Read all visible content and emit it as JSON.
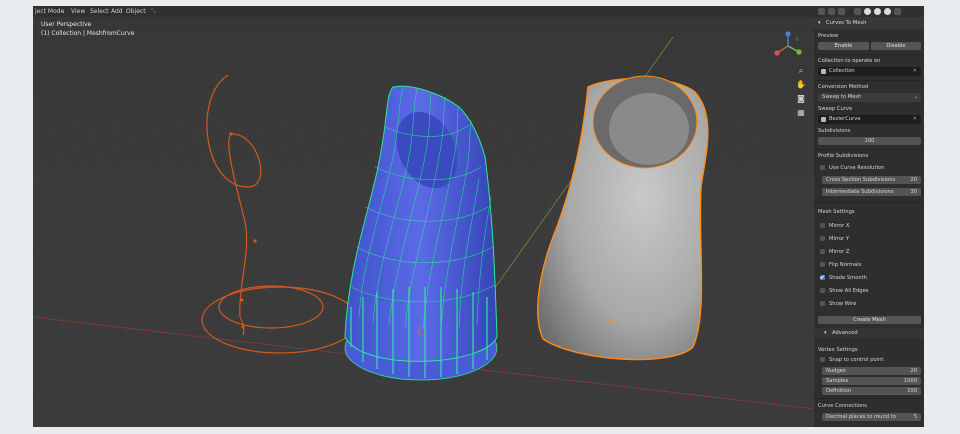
{
  "header": {
    "mode": "ject Mode",
    "menu": [
      "View",
      "Select",
      "Add",
      "Object"
    ]
  },
  "viewport": {
    "perspective": "User Perspective",
    "collection": "(1) Collection | MeshfromCurve"
  },
  "panel": {
    "title": "Curves To Mesh",
    "preview": {
      "label": "Preview",
      "enable": "Enable",
      "disable": "Disable"
    },
    "collection": {
      "label": "Collection to operate on",
      "value": "Collection"
    },
    "conversion": {
      "label": "Conversion Method",
      "value": "Sweep to Mesh"
    },
    "sweep": {
      "label": "Sweep Curve",
      "value": "BezierCurve"
    },
    "subdivisions": {
      "label": "Subdivisions",
      "value": "100"
    },
    "profile": {
      "label": "Profile Subdivisions",
      "use_curve": "Use Curve Resolution",
      "cross_label": "Cross Section Subdivisions",
      "cross_value": "20",
      "inter_label": "Intermediate Subdivisions",
      "inter_value": "30"
    },
    "mesh": {
      "label": "Mesh Settings",
      "mirror_x": "Mirror X",
      "mirror_y": "Mirror Y",
      "mirror_z": "Mirror Z",
      "flip": "Flip Normals",
      "smooth": "Shade Smooth",
      "edges": "Show All Edges",
      "wire": "Show Wire"
    },
    "create": "Create Mesh",
    "advanced": "Advanced",
    "vertex": {
      "label": "Vertex Settings",
      "snap": "Snap to control point",
      "nudges_label": "Nudges",
      "nudges_value": "20",
      "samples_label": "Samples",
      "samples_value": "1000",
      "definition_label": "Definition",
      "definition_value": "100"
    },
    "connections": {
      "label": "Curve Connections",
      "decimal_label": "Decimal places to round to",
      "decimal_value": "5"
    }
  },
  "colors": {
    "accent": "#4a7fd1",
    "selection": "#ff8c1a",
    "curve": "#d4571f",
    "mesh_blue": "#4e5fe0",
    "vertex_green": "#2ee59a"
  }
}
